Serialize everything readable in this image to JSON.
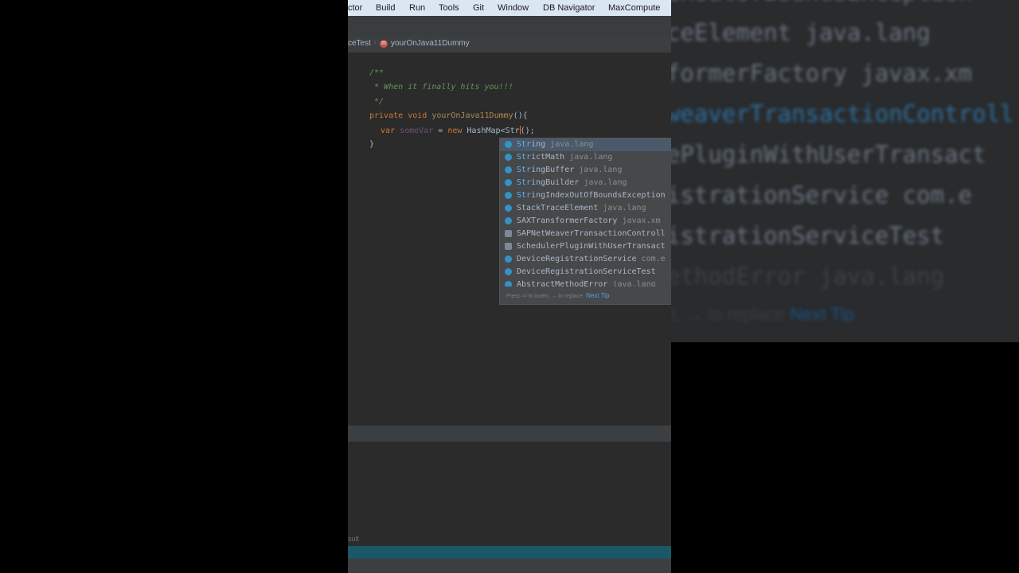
{
  "menu": {
    "items": [
      {
        "label": "ctor"
      },
      {
        "label": "Build"
      },
      {
        "label": "Run"
      },
      {
        "label": "Tools"
      },
      {
        "label": "Git"
      },
      {
        "label": "Window"
      },
      {
        "label": "DB Navigator"
      },
      {
        "label": "MaxCompute"
      }
    ]
  },
  "breadcrumb": {
    "parent": "ceTest",
    "method_badge": "m",
    "method": "yourOnJava11Dummy"
  },
  "editor": {
    "line1": "/**",
    "line2": " * When it finally hits you!!!",
    "line3": " */",
    "line4_kw1": "private",
    "line4_kw2": "void",
    "line4_fn": "yourOnJava11Dummy",
    "line4_rest": "(){",
    "line5_kw1": "var",
    "line5_var": "someVar",
    "line5_eq": " = ",
    "line5_kw2": "new",
    "line5_type": "HashMap<Str",
    "line5_after": "();",
    "line6": "}"
  },
  "completion": {
    "items": [
      {
        "hl": "Str",
        "rest": "ing",
        "pkg": "java.lang"
      },
      {
        "hl": "Str",
        "rest": "ictMath",
        "pkg": "java.lang"
      },
      {
        "hl": "Str",
        "rest": "ingBuffer",
        "pkg": "java.lang"
      },
      {
        "hl": "Str",
        "rest": "ingBuilder",
        "pkg": "java.lang"
      },
      {
        "hl": "Str",
        "rest": "ingIndexOutOfBoundsException",
        "pkg": ""
      },
      {
        "hl": "StackTraceElement",
        "rest": "",
        "pkg": "java.lang"
      },
      {
        "hl": "SAXTransformerFactory",
        "rest": "",
        "pkg": "javax.xm"
      },
      {
        "hl": "SAPNetWeaverTransactionControll",
        "rest": "",
        "pkg": ""
      },
      {
        "hl": "SchedulerPluginWithUserTransact",
        "rest": "",
        "pkg": ""
      },
      {
        "hl": "DeviceRegistrationService",
        "rest": "",
        "pkg": "com.e"
      },
      {
        "hl": "DeviceRegistrationServiceTest",
        "rest": "",
        "pkg": ""
      },
      {
        "hl": "AbstractMethodError",
        "rest": "",
        "pkg": "java.lang"
      }
    ],
    "hint": "Press ⏎ to insert, → to replace",
    "next_tip": "Next Tip"
  },
  "run_pane": {
    "label": "sult"
  },
  "blurred": {
    "lines": [
      "exOutOfBoundsException",
      "ceElement java.lang",
      "formerFactory javax.xm",
      "weaverTransactionControll",
      "ePluginWithUserTransact",
      "istrationService com.e",
      "istrationServiceTest",
      "ethodError java.lang"
    ],
    "footer": "t, → to replace",
    "footer_tip": "Next Tip"
  }
}
